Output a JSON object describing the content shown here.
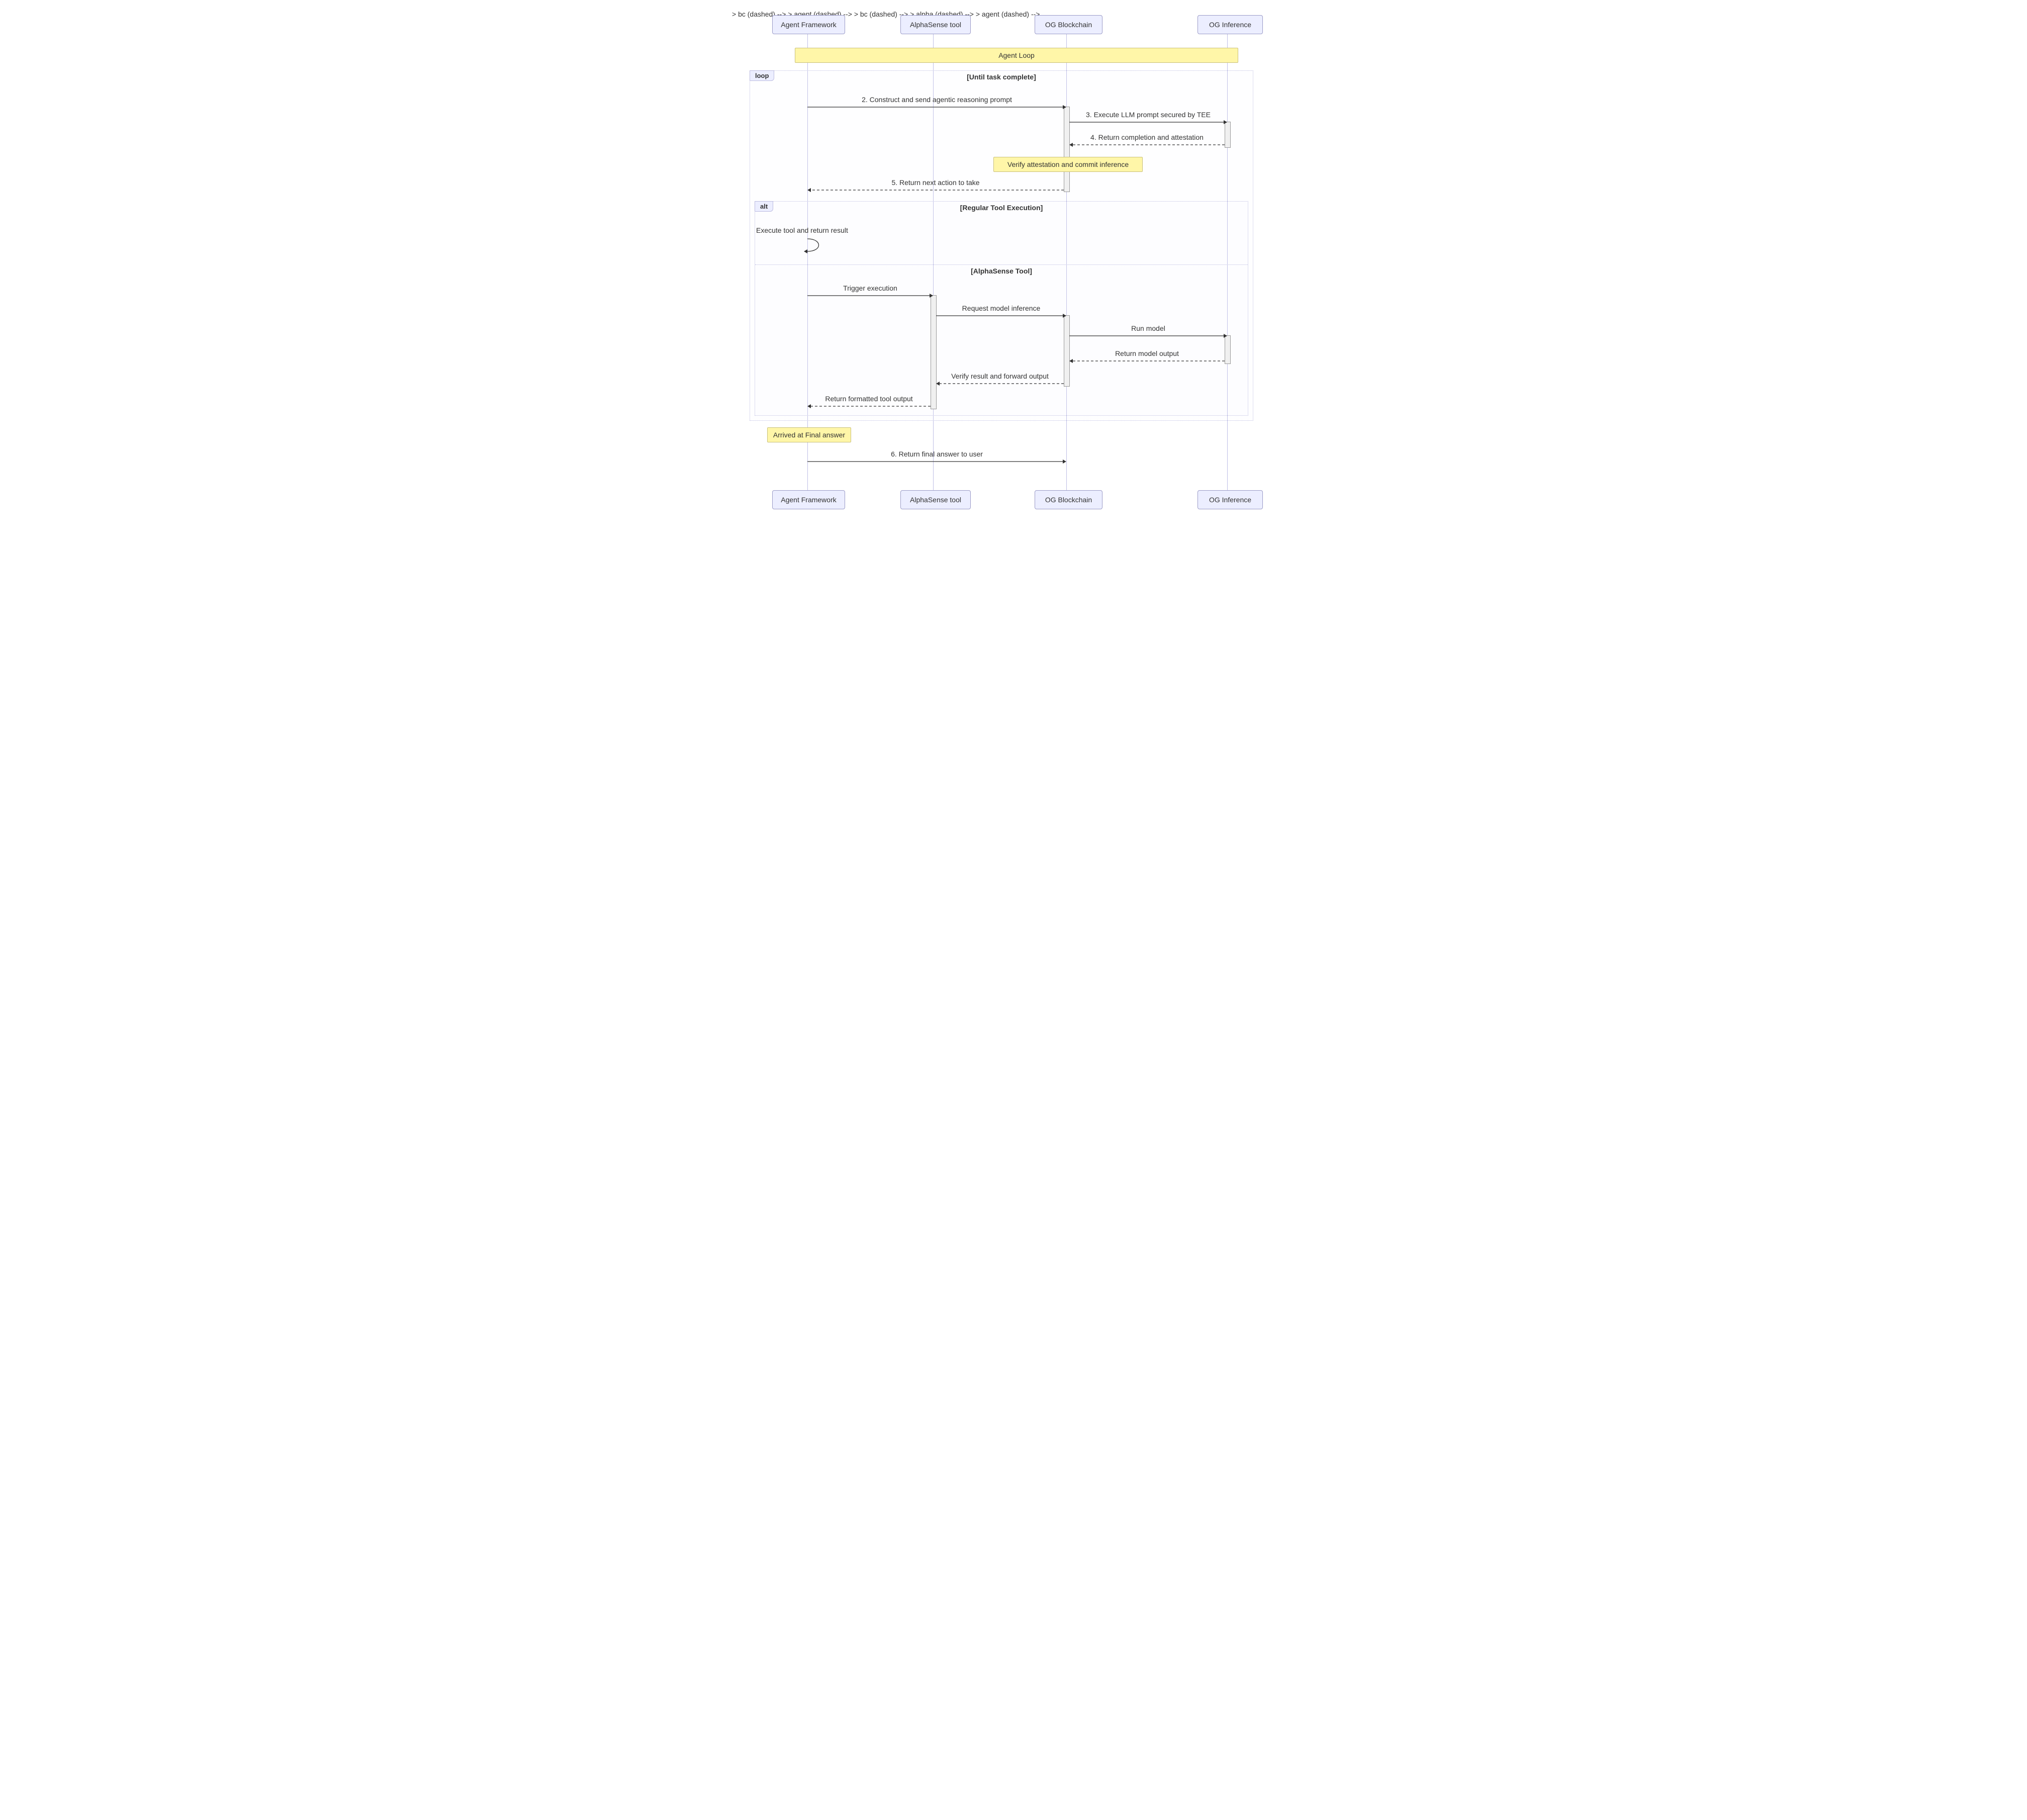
{
  "actors": {
    "agent": "Agent Framework",
    "alpha": "AlphaSense tool",
    "bc": "OG Blockchain",
    "inf": "OG Inference"
  },
  "notes": {
    "agentLoop": "Agent Loop",
    "verify": "Verify attestation and commit inference",
    "final": "Arrived at Final answer"
  },
  "frags": {
    "loopLabel": "loop",
    "loopTitle": "[Until task complete]",
    "altLabel": "alt",
    "altTitle": "[Regular Tool Execution]",
    "altSub": "[AlphaSense Tool]"
  },
  "msgs": {
    "m2": "2. Construct and send agentic reasoning prompt",
    "m3": "3. Execute LLM prompt secured by TEE",
    "m4": "4. Return completion and attestation",
    "m5": "5. Return next action to take",
    "selfloop": "Execute tool and return result",
    "trigger": "Trigger execution",
    "reqInf": "Request model inference",
    "run": "Run model",
    "retOut": "Return model output",
    "verifyFwd": "Verify result and forward output",
    "retTool": "Return formatted tool output",
    "m6": "6. Return final answer to user"
  }
}
